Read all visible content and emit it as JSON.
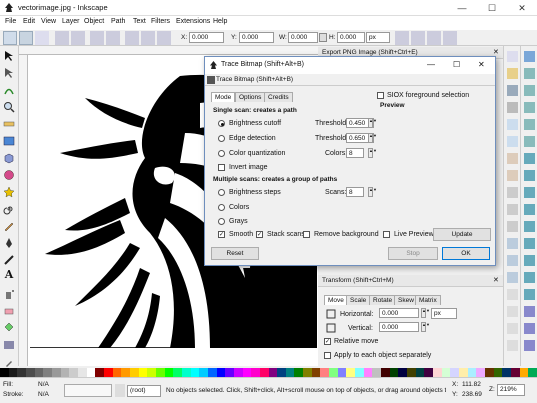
{
  "window": {
    "title": "vectorimage.jpg - Inkscape"
  },
  "menu": [
    "File",
    "Edit",
    "View",
    "Layer",
    "Object",
    "Path",
    "Text",
    "Filters",
    "Extensions",
    "Help"
  ],
  "toolbar": {
    "x_label": "X:",
    "x_value": "0.000",
    "y_label": "Y:",
    "y_value": "0.000",
    "w_label": "W:",
    "w_value": "0.000",
    "h_label": "H:",
    "h_value": "0.000",
    "unit": "px"
  },
  "export_panel": {
    "title": "Export PNG Image (Shift+Ctrl+E)"
  },
  "trace_dialog": {
    "title": "Trace Bitmap (Shift+Alt+B)",
    "subtitle": "Trace Bitmap (Shift+Alt+B)",
    "tabs": [
      "Mode",
      "Options",
      "Credits"
    ],
    "single_scan_header": "Single scan: creates a path",
    "brightness_cutoff": "Brightness cutoff",
    "edge_detection": "Edge detection",
    "color_quantization": "Color quantization",
    "invert_image": "Invert image",
    "threshold_label": "Threshold:",
    "threshold1": "0.450",
    "threshold2": "0.650",
    "colors_label": "Colors:",
    "colors_value": "8",
    "multiple_scan_header": "Multiple scans: creates a group of paths",
    "brightness_steps": "Brightness steps",
    "colors_option": "Colors",
    "grays_option": "Grays",
    "scans_label": "Scans:",
    "scans_value": "8",
    "smooth": "Smooth",
    "stack_scans": "Stack scans",
    "remove_background": "Remove background",
    "siox": "SIOX foreground selection",
    "preview_header": "Preview",
    "live_preview": "Live Preview",
    "update_button": "Update",
    "reset_button": "Reset",
    "stop_button": "Stop",
    "ok_button": "OK"
  },
  "transform_panel": {
    "title": "Transform (Shift+Ctrl+M)",
    "tabs": [
      "Move",
      "Scale",
      "Rotate",
      "Skew",
      "Matrix"
    ],
    "horizontal_label": "Horizontal:",
    "horizontal_value": "0.000",
    "vertical_label": "Vertical:",
    "vertical_value": "0.000",
    "unit": "px",
    "relative_move": "Relative move",
    "apply_each": "Apply to each object separately"
  },
  "status": {
    "fill_label": "Fill:",
    "fill_value": "N/A",
    "stroke_label": "Stroke:",
    "stroke_value": "N/A",
    "layer": "(root)",
    "message": "No objects selected. Click, Shift+click, Alt+scroll mouse on top of objects, or drag around objects to",
    "x_label": "X:",
    "x_value": "111.82",
    "y_label": "Y:",
    "y_value": "238.69",
    "z_label": "Z:",
    "zoom": "219%"
  },
  "palette_colors": [
    "#000000",
    "#1a1a1a",
    "#333333",
    "#4d4d4d",
    "#666666",
    "#808080",
    "#999999",
    "#b3b3b3",
    "#cccccc",
    "#e6e6e6",
    "#ffffff",
    "#800000",
    "#ff0000",
    "#ff6600",
    "#ff9900",
    "#ffcc00",
    "#ffff00",
    "#ccff00",
    "#66ff00",
    "#00ff00",
    "#00ff66",
    "#00ffcc",
    "#00ffff",
    "#00ccff",
    "#0066ff",
    "#0000ff",
    "#6600ff",
    "#cc00ff",
    "#ff00ff",
    "#ff00cc",
    "#ff0066",
    "#800080",
    "#004080",
    "#008080",
    "#008000",
    "#808000",
    "#804000",
    "#ff8080",
    "#80ff80",
    "#8080ff",
    "#ffff80",
    "#80ffff",
    "#ff80ff",
    "#c0c0c0",
    "#400000",
    "#004000",
    "#000040",
    "#404000",
    "#004040",
    "#400040",
    "#ffd5d5",
    "#d5ffd5",
    "#d5d5ff",
    "#ffeeaa",
    "#aaeeff",
    "#eeaaff",
    "#663300",
    "#336600",
    "#003366",
    "#660033",
    "#ffaa00",
    "#00aa55"
  ]
}
